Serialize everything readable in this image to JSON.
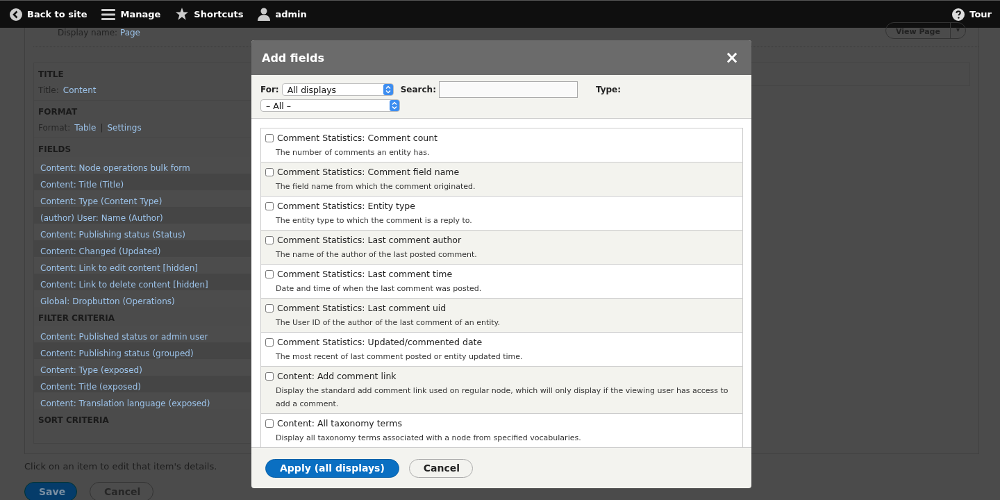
{
  "toolbar": {
    "items": [
      {
        "label": "Back to site"
      },
      {
        "label": "Manage"
      },
      {
        "label": "Shortcuts"
      },
      {
        "label": "admin"
      }
    ],
    "right": {
      "label": "Tour"
    }
  },
  "page": {
    "display_name": {
      "label": "Display name:",
      "value": "Page"
    },
    "view_button": {
      "label": "View Page",
      "caret": "▾"
    },
    "sections": [
      {
        "heading": "TITLE",
        "kind": "setting",
        "label": "Title:",
        "links": [
          "Content"
        ]
      },
      {
        "heading": "FORMAT",
        "kind": "setting",
        "label": "Format:",
        "links": [
          "Table",
          "Settings"
        ],
        "separator": "|"
      },
      {
        "heading": "FIELDS",
        "kind": "list",
        "items": [
          "Content: Node operations bulk form",
          "Content: Title (Title)",
          "Content: Type (Content Type)",
          "(author) User: Name (Author)",
          "Content: Publishing status (Status)",
          "Content: Changed (Updated)",
          "Content: Link to edit content [hidden]",
          "Content: Link to delete content [hidden]",
          "Global: Dropbutton (Operations)"
        ]
      },
      {
        "heading": "FILTER CRITERIA",
        "kind": "list",
        "items": [
          "Content: Published status or admin user",
          "Content: Publishing status (grouped)",
          "Content: Type (exposed)",
          "Content: Title (exposed)",
          "Content: Translation language (exposed)"
        ]
      },
      {
        "heading": "SORT CRITERIA",
        "kind": "list"
      }
    ],
    "hint": "Click on an item to edit that item's details.",
    "buttons": [
      {
        "label": "Save",
        "kind": "primary"
      },
      {
        "label": "Cancel",
        "kind": "secondary"
      }
    ]
  },
  "dialog": {
    "title": "Add fields",
    "close": "×",
    "filters": {
      "for_label": "For:",
      "for_value": "All displays",
      "search_label": "Search:",
      "type_label": "Type:",
      "type_value": "– All –"
    },
    "fields": [
      {
        "title": "Comment Statistics: Comment count",
        "description": "The number of comments an entity has.",
        "checked": false
      },
      {
        "title": "Comment Statistics: Comment field name",
        "description": "The field name from which the comment originated.",
        "checked": false
      },
      {
        "title": "Comment Statistics: Entity type",
        "description": "The entity type to which the comment is a reply to.",
        "checked": false
      },
      {
        "title": "Comment Statistics: Last comment author",
        "description": "The name of the author of the last posted comment.",
        "checked": false
      },
      {
        "title": "Comment Statistics: Last comment time",
        "description": "Date and time of when the last comment was posted.",
        "checked": false
      },
      {
        "title": "Comment Statistics: Last comment uid",
        "description": "The User ID of the author of the last comment of an entity.",
        "checked": false
      },
      {
        "title": "Comment Statistics: Updated/commented date",
        "description": "The most recent of last comment posted or entity updated time.",
        "checked": false
      },
      {
        "title": "Content: Add comment link",
        "description": "Display the standard add comment link used on regular node, which will only display if the viewing user has access to add a comment.",
        "checked": false
      },
      {
        "title": "Content: All taxonomy terms",
        "description": "Display all taxonomy terms associated with a node from specified vocabularies.",
        "checked": false
      }
    ],
    "buttons": [
      {
        "label": "Apply (all displays)",
        "kind": "primary"
      },
      {
        "label": "Cancel",
        "kind": "secondary"
      }
    ]
  }
}
